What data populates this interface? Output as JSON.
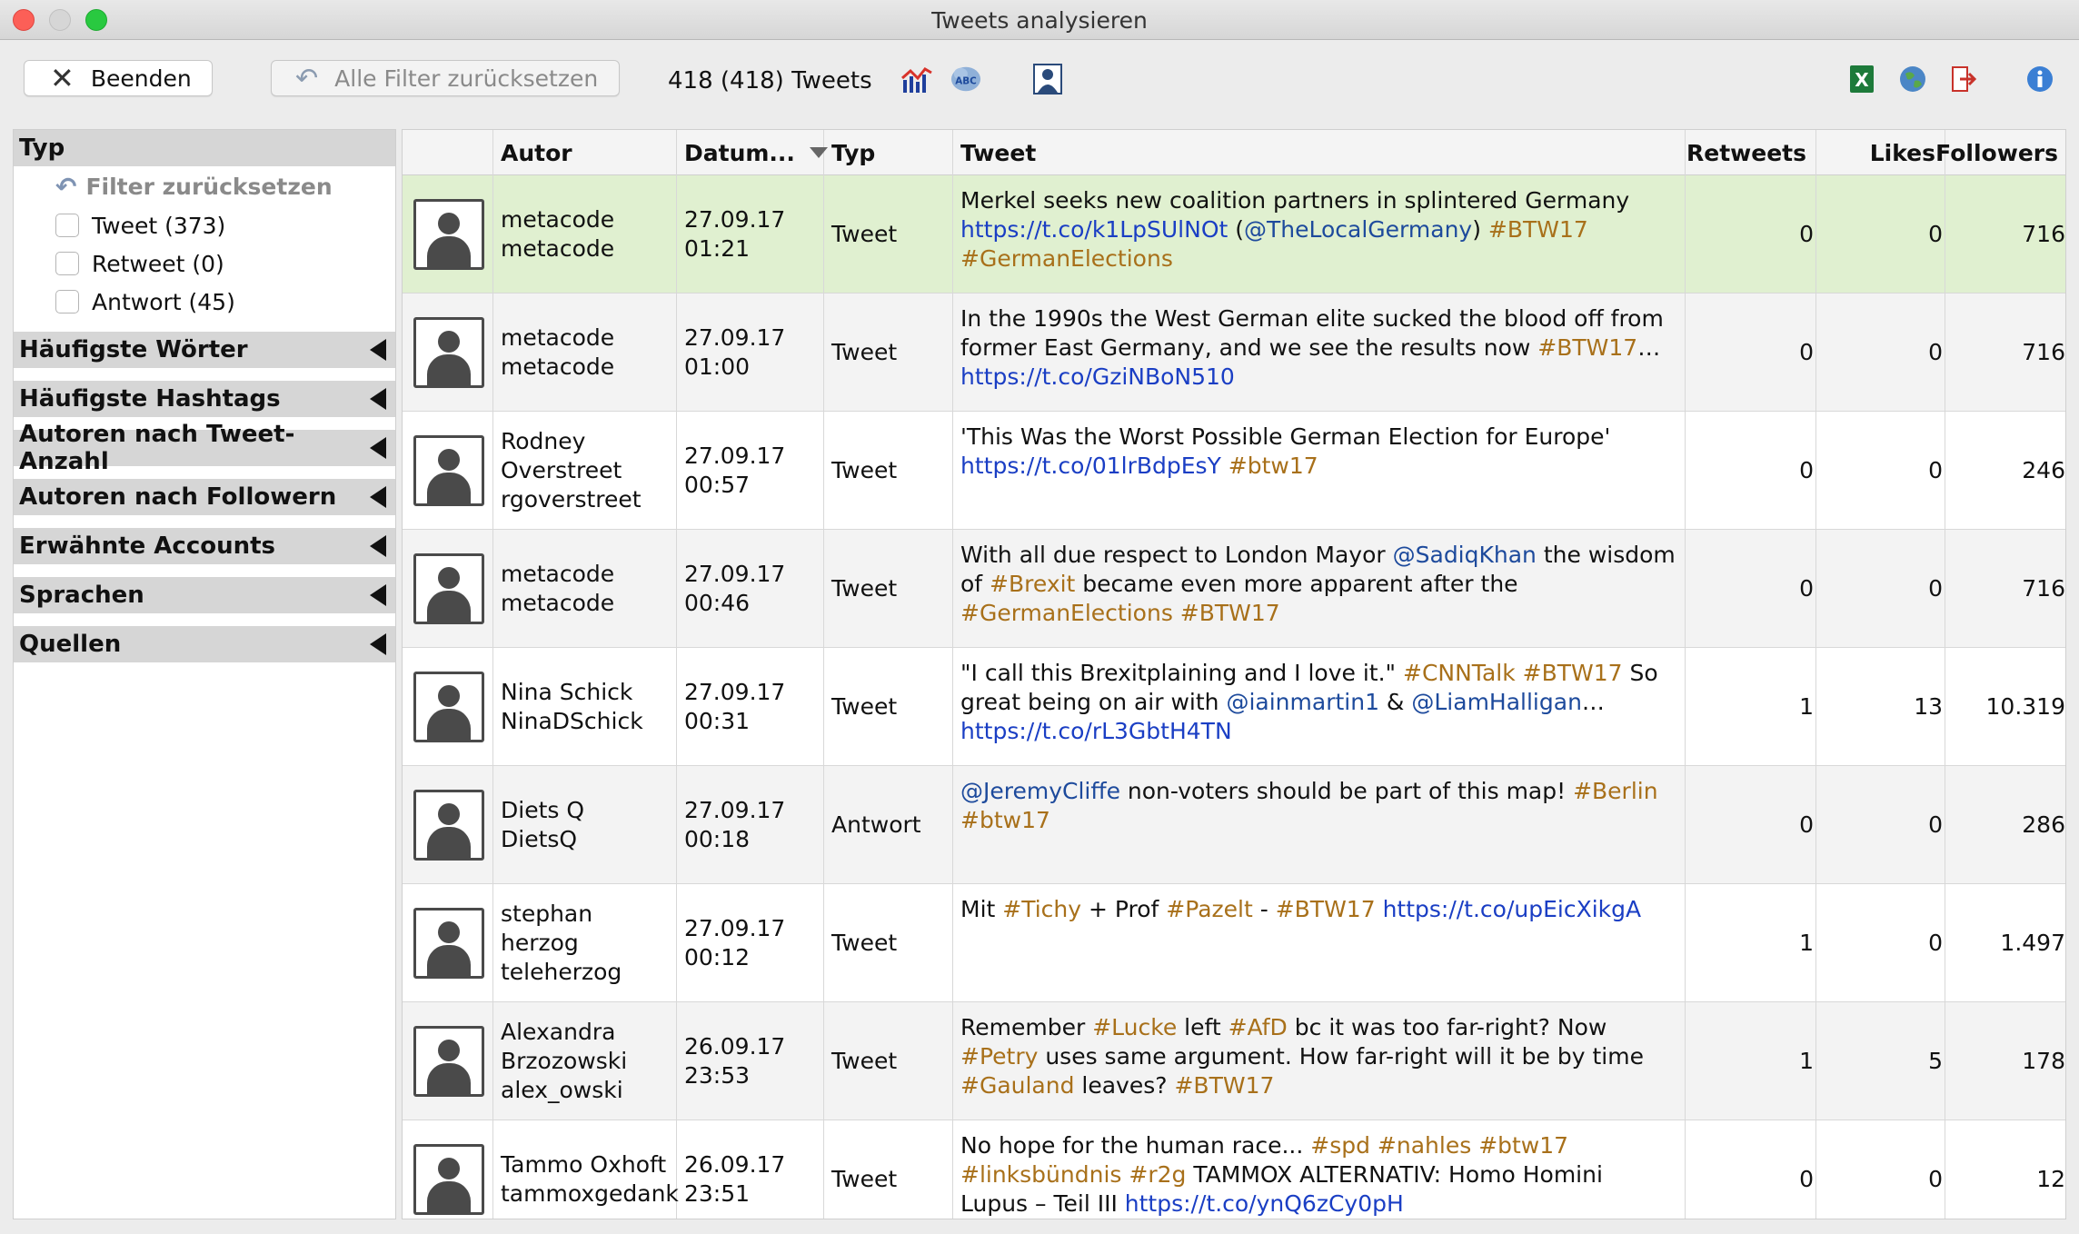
{
  "window": {
    "title": "Tweets analysieren"
  },
  "toolbar": {
    "quit_label": "Beenden",
    "reset_filters_label": "Alle Filter zurücksetzen",
    "tweet_count": "418 (418) Tweets",
    "icons": [
      "chart-icon",
      "word-cloud-icon",
      "person-icon",
      "excel-icon",
      "globe-icon",
      "export-icon",
      "info-icon"
    ]
  },
  "sidebar": {
    "type_header": "Typ",
    "reset_label": "Filter zurücksetzen",
    "checks": [
      {
        "label": "Tweet (373)"
      },
      {
        "label": "Retweet (0)"
      },
      {
        "label": "Antwort (45)"
      }
    ],
    "sections": [
      "Häufigste Wörter",
      "Häufigste Hashtags",
      "Autoren nach Tweet-Anzahl",
      "Autoren nach Followern",
      "Erwähnte Accounts",
      "Sprachen",
      "Quellen"
    ]
  },
  "table": {
    "columns": [
      "Autor",
      "Datum...",
      "Typ",
      "Tweet",
      "Retweets",
      "Likes",
      "Followers"
    ],
    "rows": [
      {
        "author": [
          "metacode",
          "metacode"
        ],
        "date": [
          "27.09.17",
          "01:21"
        ],
        "type": "Tweet",
        "tweet": [
          [
            [
              "t",
              "Merkel seeks new coalition partners in splintered Germany"
            ]
          ],
          [
            [
              "l",
              "https://t.co/k1LpSUlNOt"
            ],
            [
              "t",
              " ("
            ],
            [
              "m",
              "@TheLocalGermany"
            ],
            [
              "t",
              ") "
            ],
            [
              "h",
              "#BTW17"
            ]
          ],
          [
            [
              "h",
              "#GermanElections"
            ]
          ]
        ],
        "retweets": "0",
        "likes": "0",
        "followers": "716"
      },
      {
        "author": [
          "metacode",
          "metacode"
        ],
        "date": [
          "27.09.17",
          "01:00"
        ],
        "type": "Tweet",
        "tweet": [
          [
            [
              "t",
              "In the 1990s the West German elite sucked the blood off from"
            ]
          ],
          [
            [
              "t",
              "former East Germany, and we see the results now "
            ],
            [
              "h",
              "#BTW17"
            ],
            [
              "t",
              "…"
            ]
          ],
          [
            [
              "l",
              "https://t.co/GziNBoN510"
            ]
          ]
        ],
        "retweets": "0",
        "likes": "0",
        "followers": "716"
      },
      {
        "author": [
          "Rodney",
          "Overstreet",
          "rgoverstreet"
        ],
        "date": [
          "27.09.17",
          "00:57"
        ],
        "type": "Tweet",
        "tweet": [
          [
            [
              "t",
              "'This Was the Worst Possible German Election for Europe'"
            ]
          ],
          [
            [
              "l",
              "https://t.co/01lrBdpEsY"
            ],
            [
              "t",
              " "
            ],
            [
              "h",
              "#btw17"
            ]
          ]
        ],
        "retweets": "0",
        "likes": "0",
        "followers": "246"
      },
      {
        "author": [
          "metacode",
          "metacode"
        ],
        "date": [
          "27.09.17",
          "00:46"
        ],
        "type": "Tweet",
        "tweet": [
          [
            [
              "t",
              "With all due respect to London Mayor "
            ],
            [
              "m",
              "@SadiqKhan"
            ],
            [
              "t",
              " the wisdom"
            ]
          ],
          [
            [
              "t",
              "of "
            ],
            [
              "h",
              "#Brexit"
            ],
            [
              "t",
              " became even more apparent after the"
            ]
          ],
          [
            [
              "h",
              "#GermanElections"
            ],
            [
              "t",
              " "
            ],
            [
              "h",
              "#BTW17"
            ]
          ]
        ],
        "retweets": "0",
        "likes": "0",
        "followers": "716"
      },
      {
        "author": [
          "Nina Schick",
          "NinaDSchick"
        ],
        "date": [
          "27.09.17",
          "00:31"
        ],
        "type": "Tweet",
        "tweet": [
          [
            [
              "t",
              "\"I call this Brexitplaining and I love it.\" "
            ],
            [
              "h",
              "#CNNTalk"
            ],
            [
              "t",
              " "
            ],
            [
              "h",
              "#BTW17"
            ],
            [
              "t",
              " So"
            ]
          ],
          [
            [
              "t",
              "great being on air with "
            ],
            [
              "m",
              "@iainmartin1"
            ],
            [
              "t",
              " & "
            ],
            [
              "m",
              "@LiamHalligan"
            ],
            [
              "t",
              "…"
            ]
          ],
          [
            [
              "l",
              "https://t.co/rL3GbtH4TN"
            ]
          ]
        ],
        "retweets": "1",
        "likes": "13",
        "followers": "10.319"
      },
      {
        "author": [
          "Diets Q",
          "DietsQ"
        ],
        "date": [
          "27.09.17",
          "00:18"
        ],
        "type": "Antwort",
        "tweet": [
          [
            [
              "m",
              "@JeremyCliffe"
            ],
            [
              "t",
              " non-voters should be part of this map! "
            ],
            [
              "h",
              "#Berlin"
            ]
          ],
          [
            [
              "h",
              "#btw17"
            ]
          ]
        ],
        "retweets": "0",
        "likes": "0",
        "followers": "286"
      },
      {
        "author": [
          "stephan",
          "herzog",
          "teleherzog"
        ],
        "date": [
          "27.09.17",
          "00:12"
        ],
        "type": "Tweet",
        "tweet": [
          [
            [
              "t",
              "Mit "
            ],
            [
              "h",
              "#Tichy"
            ],
            [
              "t",
              " + Prof "
            ],
            [
              "h",
              "#Pazelt"
            ],
            [
              "t",
              " - "
            ],
            [
              "h",
              "#BTW17"
            ],
            [
              "t",
              " "
            ],
            [
              "l",
              "https://t.co/upEicXikgA"
            ]
          ]
        ],
        "retweets": "1",
        "likes": "0",
        "followers": "1.497"
      },
      {
        "author": [
          "Alexandra",
          "Brzozowski",
          "alex_owski"
        ],
        "date": [
          "26.09.17",
          "23:53"
        ],
        "type": "Tweet",
        "tweet": [
          [
            [
              "t",
              "Remember "
            ],
            [
              "h",
              "#Lucke"
            ],
            [
              "t",
              " left "
            ],
            [
              "h",
              "#AfD"
            ],
            [
              "t",
              " bc it was too far-right? Now"
            ]
          ],
          [
            [
              "h",
              "#Petry"
            ],
            [
              "t",
              " uses same argument. How far-right will it be by time"
            ]
          ],
          [
            [
              "h",
              "#Gauland"
            ],
            [
              "t",
              " leaves? "
            ],
            [
              "h",
              "#BTW17"
            ]
          ]
        ],
        "retweets": "1",
        "likes": "5",
        "followers": "178"
      },
      {
        "author": [
          "Tammo Oxhoft",
          "tammoxgedank"
        ],
        "date": [
          "26.09.17",
          "23:51"
        ],
        "type": "Tweet",
        "tweet": [
          [
            [
              "t",
              "No hope for the human race... "
            ],
            [
              "h",
              "#spd"
            ],
            [
              "t",
              " "
            ],
            [
              "h",
              "#nahles"
            ],
            [
              "t",
              " "
            ],
            [
              "h",
              "#btw17"
            ]
          ],
          [
            [
              "h",
              "#linksbündnis"
            ],
            [
              "t",
              " "
            ],
            [
              "h",
              "#r2g"
            ],
            [
              "t",
              " TAMMOX ALTERNATIV: Homo Homini"
            ]
          ],
          [
            [
              "t",
              "Lupus – Teil III "
            ],
            [
              "l",
              "https://t.co/ynQ6zCy0pH"
            ]
          ]
        ],
        "retweets": "0",
        "likes": "0",
        "followers": "12"
      }
    ]
  }
}
